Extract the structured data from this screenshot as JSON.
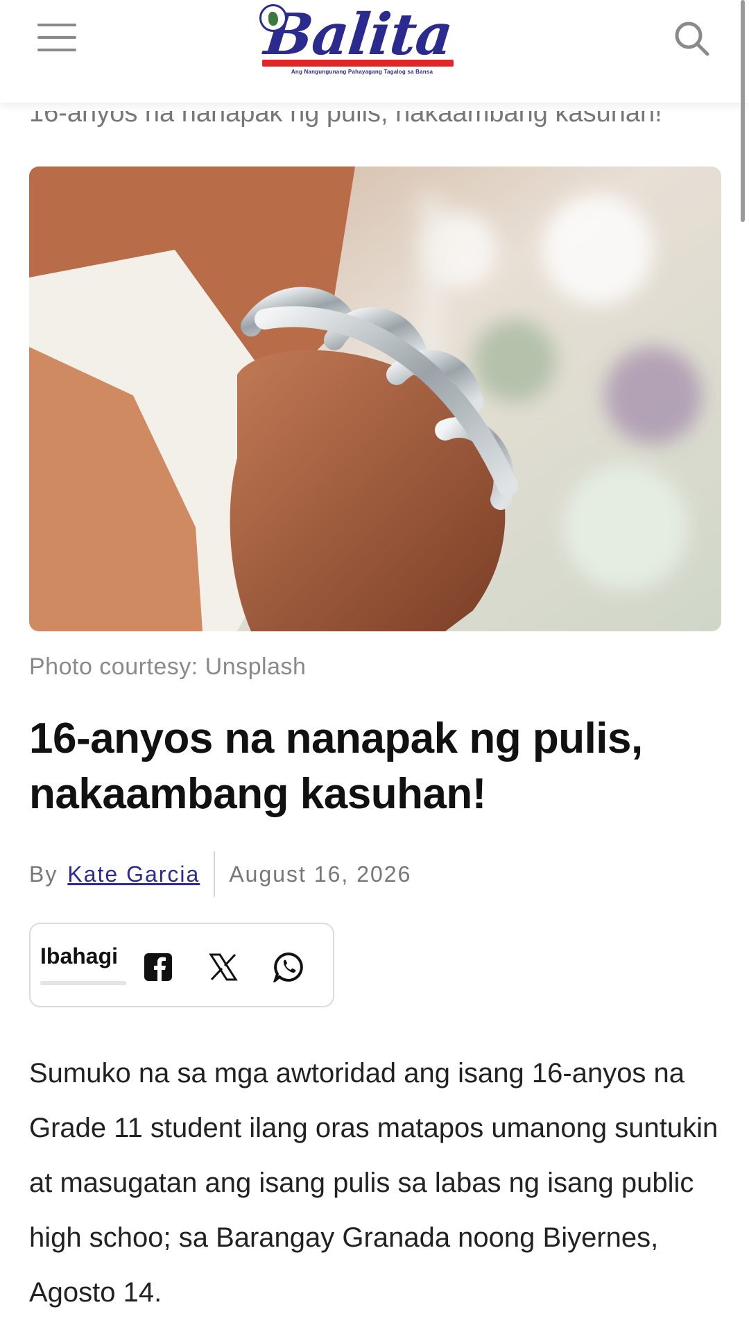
{
  "header": {
    "logo_text": "Balita",
    "logo_tagline": "Ang Nangungunang Pahayagang Tagalog sa Bansa",
    "menu_icon": "hamburger-menu-icon",
    "search_icon": "search-icon"
  },
  "article": {
    "breadcrumb_title": "16-anyos na nanapak ng pulis, nakaambang kasuhan!",
    "image_caption": "Photo courtesy: Unsplash",
    "headline": "16-anyos na nanapak ng pulis, nakaambang kasuhan!",
    "byline_prefix": "By",
    "author": "Kate Garcia",
    "date": "August 16, 2026",
    "body_paragraph": "Sumuko na sa mga awtoridad ang isang 16-anyos na Grade 11 student ilang oras matapos umanong suntukin at masugatan ang isang pulis sa labas ng isang public high schoo;  sa Barangay Granada noong Biyernes, Agosto 14."
  },
  "share": {
    "label": "Ibahagi",
    "icons": [
      "facebook-icon",
      "x-icon",
      "whatsapp-icon"
    ]
  },
  "colors": {
    "brand_blue": "#2b2b8f",
    "brand_red": "#e02626",
    "text": "#111111",
    "muted": "#777777"
  }
}
